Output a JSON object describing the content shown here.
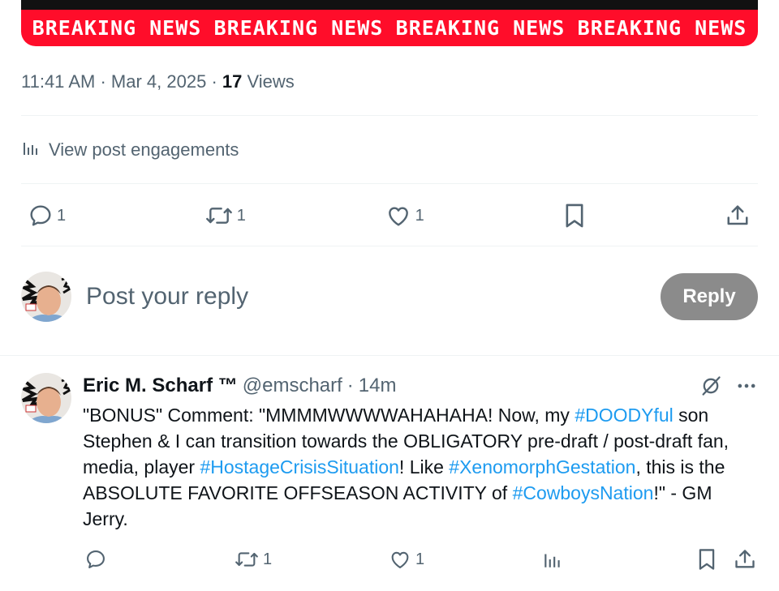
{
  "banner": {
    "items": [
      "BREAKING NEWS",
      "BREAKING NEWS",
      "BREAKING NEWS",
      "BREAKING NEWS"
    ]
  },
  "post_meta": {
    "time": "11:41 AM",
    "date": "Mar 4, 2025",
    "views_count": "17",
    "views_label": "Views"
  },
  "engagements": {
    "label": "View post engagements",
    "icon": "analytics-icon"
  },
  "actions": {
    "replies": "1",
    "reposts": "1",
    "likes": "1"
  },
  "compose": {
    "placeholder": "Post your reply",
    "button_label": "Reply"
  },
  "reply": {
    "name": "Eric M. Scharf ™",
    "handle": "@emscharf",
    "time": "14m",
    "segments": [
      {
        "text": "\"BONUS\" Comment: \"MMMMWWWWAHAHAHA! Now, my ",
        "tag": false
      },
      {
        "text": "#DOODYful",
        "tag": true
      },
      {
        "text": " son Stephen & I can transition towards the OBLIGATORY pre-draft / post-draft fan, media, player ",
        "tag": false
      },
      {
        "text": "#HostageCrisisSituation",
        "tag": true
      },
      {
        "text": "! Like ",
        "tag": false
      },
      {
        "text": "#XenomorphGestation",
        "tag": true
      },
      {
        "text": ", this is the ABSOLUTE FAVORITE OFFSEASON ACTIVITY of ",
        "tag": false
      },
      {
        "text": "#CowboysNation",
        "tag": true
      },
      {
        "text": "!\" - GM Jerry.",
        "tag": false
      }
    ],
    "actions": {
      "replies": "",
      "reposts": "1",
      "likes": "1"
    }
  },
  "colors": {
    "banner_red": "#ff0d2a",
    "link_blue": "#1d9bf0",
    "muted_gray": "#536471",
    "reply_button_gray": "#8b8b8b"
  }
}
